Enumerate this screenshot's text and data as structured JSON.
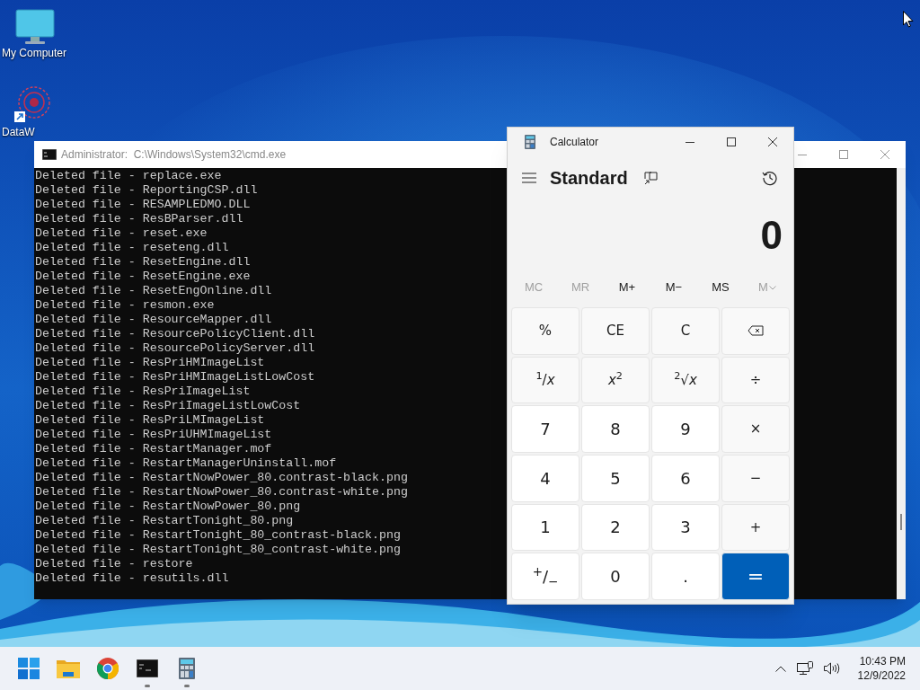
{
  "desktop": {
    "icons": [
      {
        "label": "My Computer",
        "kind": "computer"
      },
      {
        "label": "DataW",
        "kind": "shortcut"
      }
    ]
  },
  "cmd_window": {
    "title": "Administrator:  C:\\Windows\\System32\\cmd.exe",
    "lines": [
      "Deleted file - replace.exe",
      "Deleted file - ReportingCSP.dll",
      "Deleted file - RESAMPLEDMO.DLL",
      "Deleted file - ResBParser.dll",
      "Deleted file - reset.exe",
      "Deleted file - reseteng.dll",
      "Deleted file - ResetEngine.dll",
      "Deleted file - ResetEngine.exe",
      "Deleted file - ResetEngOnline.dll",
      "Deleted file - resmon.exe",
      "Deleted file - ResourceMapper.dll",
      "Deleted file - ResourcePolicyClient.dll",
      "Deleted file - ResourcePolicyServer.dll",
      "Deleted file - ResPriHMImageList",
      "Deleted file - ResPriHMImageListLowCost",
      "Deleted file - ResPriImageList",
      "Deleted file - ResPriImageListLowCost",
      "Deleted file - ResPriLMImageList",
      "Deleted file - ResPriUHMImageList",
      "Deleted file - RestartManager.mof",
      "Deleted file - RestartManagerUninstall.mof",
      "Deleted file - RestartNowPower_80.contrast-black.png",
      "Deleted file - RestartNowPower_80.contrast-white.png",
      "Deleted file - RestartNowPower_80.png",
      "Deleted file - RestartTonight_80.png",
      "Deleted file - RestartTonight_80_contrast-black.png",
      "Deleted file - RestartTonight_80_contrast-white.png",
      "Deleted file - restore",
      "Deleted file - resutils.dll"
    ]
  },
  "calculator": {
    "title": "Calculator",
    "mode": "Standard",
    "display": "0",
    "memory": [
      {
        "label": "MC",
        "disabled": true,
        "kind": "plain"
      },
      {
        "label": "MR",
        "disabled": true,
        "kind": "plain"
      },
      {
        "label": "M+",
        "disabled": false,
        "kind": "plain"
      },
      {
        "label": "M−",
        "disabled": false,
        "kind": "plain"
      },
      {
        "label": "MS",
        "disabled": false,
        "kind": "plain"
      },
      {
        "label": "M",
        "disabled": true,
        "kind": "dropdown"
      }
    ],
    "keys": [
      {
        "label": "%",
        "kind": "function"
      },
      {
        "label": "CE",
        "kind": "function"
      },
      {
        "label": "C",
        "kind": "function"
      },
      {
        "kind": "backspace"
      },
      {
        "label": "$^{1}$/*x*",
        "kind": "function"
      },
      {
        "label": "*x*$^{2}$",
        "kind": "function"
      },
      {
        "label": "$^{2}$√*x*",
        "kind": "function"
      },
      {
        "label": "÷",
        "kind": "function"
      },
      {
        "label": "7",
        "kind": "digit"
      },
      {
        "label": "8",
        "kind": "digit"
      },
      {
        "label": "9",
        "kind": "digit"
      },
      {
        "label": "×",
        "kind": "function"
      },
      {
        "label": "4",
        "kind": "digit"
      },
      {
        "label": "5",
        "kind": "digit"
      },
      {
        "label": "6",
        "kind": "digit"
      },
      {
        "label": "−",
        "kind": "function"
      },
      {
        "label": "1",
        "kind": "digit"
      },
      {
        "label": "2",
        "kind": "digit"
      },
      {
        "label": "3",
        "kind": "digit"
      },
      {
        "label": "+",
        "kind": "function"
      },
      {
        "label": "$^{+}$/$_{−}$",
        "kind": "digit"
      },
      {
        "label": "0",
        "kind": "digit"
      },
      {
        "label": ".",
        "kind": "digit"
      },
      {
        "label": "=",
        "kind": "equals"
      }
    ]
  },
  "taskbar": {
    "apps": [
      {
        "kind": "start",
        "running": false
      },
      {
        "kind": "folder",
        "running": false
      },
      {
        "kind": "browser",
        "running": false
      },
      {
        "kind": "terminal",
        "running": true
      },
      {
        "kind": "calculator",
        "running": true
      }
    ],
    "clock": {
      "time": "10:43 PM",
      "date": "12/9/2022"
    }
  }
}
